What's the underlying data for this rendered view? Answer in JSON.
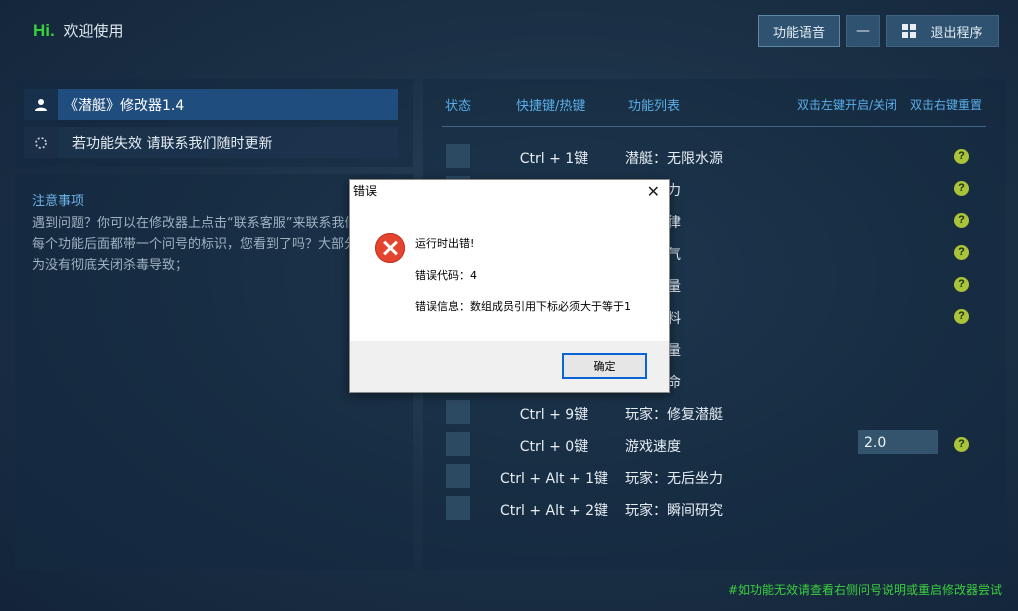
{
  "header": {
    "brand_hi": "Hi.",
    "welcome": "欢迎使用",
    "voice_button": "功能语音",
    "minimize_glyph": "—",
    "exit_button": "退出程序"
  },
  "left": {
    "trainer_title": "《潜艇》修改器1.4",
    "update_text": "若功能失效  请联系我们随时更新",
    "notice_title": "注意事项",
    "notice_body": "遇到问题？你可以在修改器上点击“联系客服”来联系我们；提示：每个功能后面都带一个问号的标识，您看到了吗？大部分用户是因为没有彻底关闭杀毒导致；"
  },
  "table": {
    "headers": {
      "status": "状态",
      "hotkey": "快捷键/热键",
      "function": "功能列表",
      "hint_toggle": "双击左键开启/关闭",
      "hint_reset": "双击右键重置"
    },
    "rows": [
      {
        "key": "Ctrl + 1键",
        "fn": "潜艇：无限水源",
        "help": "?"
      },
      {
        "key": "",
        "fn": "无限压力",
        "help": "?"
      },
      {
        "key": "",
        "fn": "完美纪律",
        "help": "?"
      },
      {
        "key": "",
        "fn": "无限氧气",
        "help": "?"
      },
      {
        "key": "",
        "fn": "无限能量",
        "help": "?"
      },
      {
        "key": "",
        "fn": "无限燃料",
        "help": "?"
      },
      {
        "key": "",
        "fn": "无限能量",
        "help": ""
      },
      {
        "key": "",
        "fn": "无限生命",
        "help": ""
      },
      {
        "key": "Ctrl + 9键",
        "fn": "玩家：修复潜艇",
        "help": ""
      },
      {
        "key": "Ctrl + 0键",
        "fn": "游戏速度",
        "help": "?"
      },
      {
        "key": "Ctrl + Alt + 1键",
        "fn": "玩家：无后坐力",
        "help": ""
      },
      {
        "key": "Ctrl + Alt + 2键",
        "fn": "玩家：瞬间研究",
        "help": ""
      }
    ],
    "speed_value": "2.0"
  },
  "footer_note": "#如功能无效请查看右侧问号说明或重启修改器尝试",
  "dialog": {
    "title": "错误",
    "close_glyph": "✕",
    "line1": "运行时出错!",
    "line2": "错误代码：4",
    "line3": "错误信息：数组成员引用下标必须大于等于1",
    "ok_button": "确定"
  }
}
